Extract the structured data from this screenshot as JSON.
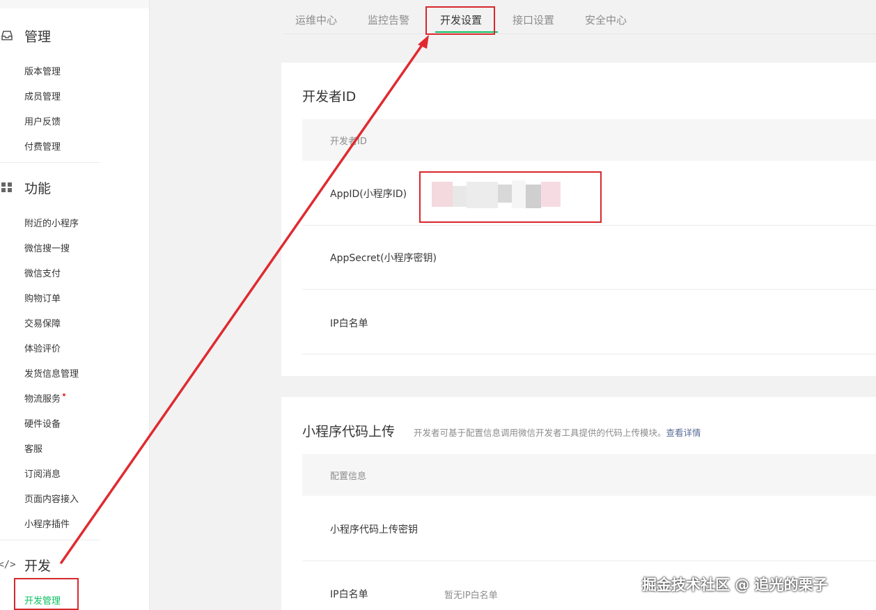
{
  "sidebar": {
    "sections": [
      {
        "label": "管理",
        "icon": "inbox-icon",
        "items": [
          "版本管理",
          "成员管理",
          "用户反馈",
          "付费管理"
        ]
      },
      {
        "label": "功能",
        "icon": "grid-icon",
        "items": [
          "附近的小程序",
          "微信搜一搜",
          "微信支付",
          "购物订单",
          "交易保障",
          "体验评价",
          "发货信息管理",
          "物流服务",
          "硬件设备",
          "客服",
          "订阅消息",
          "页面内容接入",
          "小程序插件"
        ]
      },
      {
        "label": "开发",
        "icon": "code-icon",
        "items": [
          "开发管理"
        ]
      }
    ],
    "active_item": "开发管理"
  },
  "tabs": [
    {
      "label": "运维中心"
    },
    {
      "label": "监控告警"
    },
    {
      "label": "开发设置"
    },
    {
      "label": "接口设置"
    },
    {
      "label": "安全中心"
    }
  ],
  "active_tab": "开发设置",
  "developer_id": {
    "title": "开发者ID",
    "column_header": "开发者ID",
    "rows": [
      {
        "label": "AppID(小程序ID)"
      },
      {
        "label": "AppSecret(小程序密钥)"
      },
      {
        "label": "IP白名单"
      }
    ]
  },
  "code_upload": {
    "title": "小程序代码上传",
    "description": "开发者可基于配置信息调用微信开发者工具提供的代码上传模块。",
    "link": "查看详情",
    "column_header": "配置信息",
    "rows": [
      {
        "label": "小程序代码上传密钥",
        "value": ""
      },
      {
        "label": "IP白名单",
        "value": "暂无IP白名单"
      }
    ]
  },
  "watermark": "掘金技术社区 @ 追光的栗子",
  "colors": {
    "accent": "#07c160",
    "annotation": "#d7272c",
    "link": "#576b95"
  }
}
